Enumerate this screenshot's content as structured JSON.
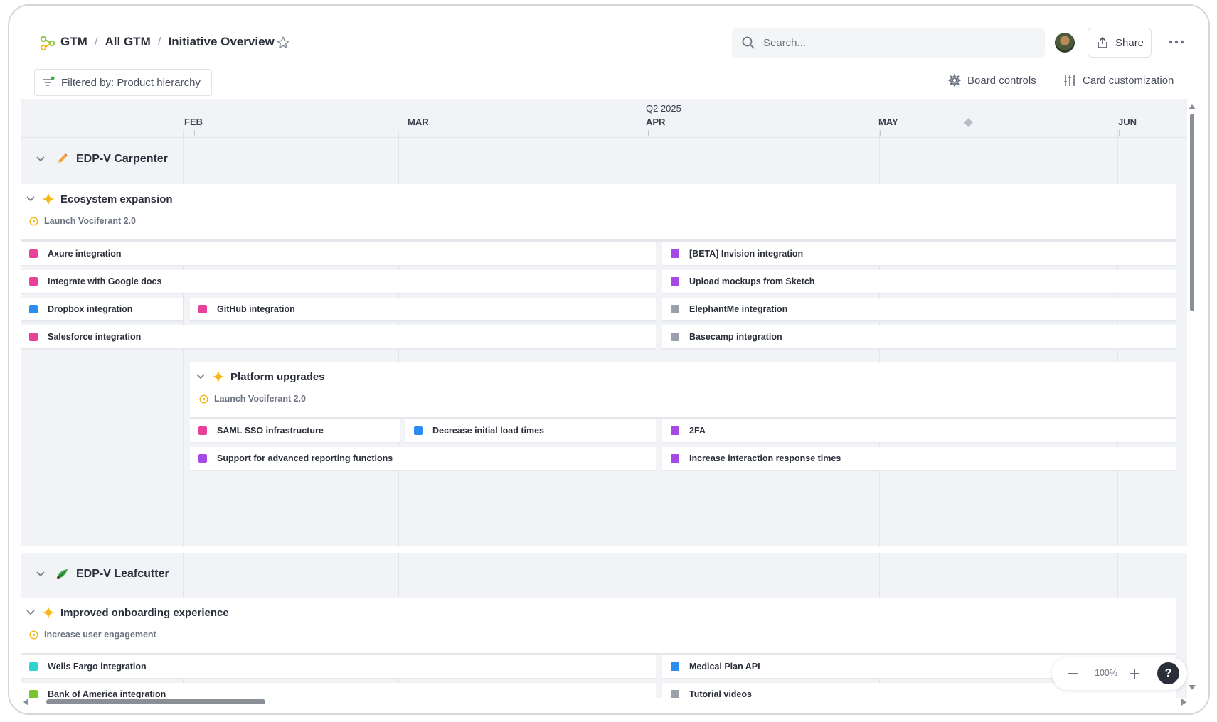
{
  "breadcrumb": [
    "GTM",
    "All GTM",
    "Initiative Overview"
  ],
  "search": {
    "placeholder": "Search..."
  },
  "share_label": "Share",
  "filter_label": "Filtered by: Product hierarchy",
  "board_controls_label": "Board controls",
  "card_customization_label": "Card customization",
  "timeline": {
    "quarter_label": "Q2 2025",
    "months": [
      "FEB",
      "MAR",
      "APR",
      "MAY",
      "JUN"
    ]
  },
  "groups": [
    {
      "name": "EDP-V Carpenter",
      "icon": "carpenter-pencil-icon",
      "lanes": [
        {
          "title": "Ecosystem expansion",
          "goal": "Launch Vociferant 2.0",
          "cards": [
            {
              "label": "Axure integration",
              "color": "#e8409b"
            },
            {
              "label": "[BETA] Invision integration",
              "color": "#a54ae6"
            },
            {
              "label": "Integrate with Google docs",
              "color": "#e8409b"
            },
            {
              "label": "Upload mockups from Sketch",
              "color": "#a54ae6"
            },
            {
              "label": "Dropbox integration",
              "color": "#2b8df0"
            },
            {
              "label": "GitHub integration",
              "color": "#e8409b"
            },
            {
              "label": "ElephantMe integration",
              "color": "#9aa1ab"
            },
            {
              "label": "Salesforce integration",
              "color": "#e8409b"
            },
            {
              "label": "Basecamp integration",
              "color": "#9aa1ab"
            }
          ]
        },
        {
          "title": "Platform upgrades",
          "goal": "Launch Vociferant 2.0",
          "cards": [
            {
              "label": "SAML SSO infrastructure",
              "color": "#e8409b"
            },
            {
              "label": "Decrease initial load times",
              "color": "#2b8df0"
            },
            {
              "label": "2FA",
              "color": "#a54ae6"
            },
            {
              "label": "Support for advanced reporting functions",
              "color": "#a54ae6"
            },
            {
              "label": "Increase interaction response times",
              "color": "#a54ae6"
            }
          ]
        }
      ]
    },
    {
      "name": "EDP-V Leafcutter",
      "icon": "leafcutter-ant-icon",
      "lanes": [
        {
          "title": "Improved onboarding experience",
          "goal": "Increase user engagement",
          "cards": [
            {
              "label": "Wells Fargo integration",
              "color": "#2ed3cf"
            },
            {
              "label": "Medical Plan API",
              "color": "#2b8df0"
            },
            {
              "label": "Bank of America integration",
              "color": "#7ac52e"
            },
            {
              "label": "Tutorial videos",
              "color": "#9aa1ab"
            }
          ]
        }
      ]
    }
  ],
  "zoom": {
    "value": "100%",
    "help": "?"
  },
  "colors": {
    "accent_yellow": "#f5b81c",
    "today_line": "#a9c9ea"
  }
}
